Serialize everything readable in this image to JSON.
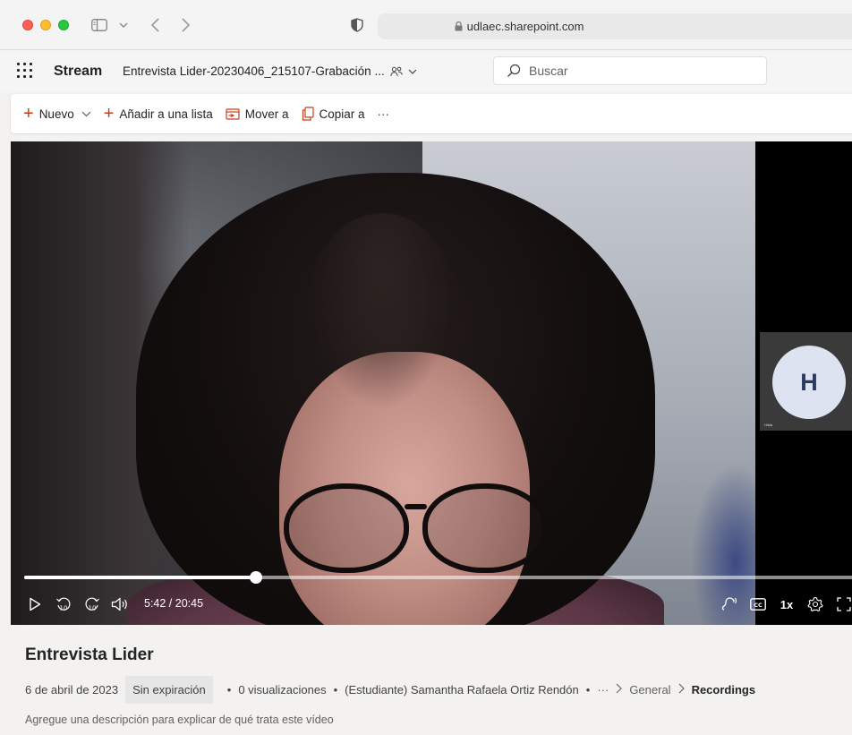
{
  "browser": {
    "url": "udlaec.sharepoint.com"
  },
  "app": {
    "name": "Stream",
    "document_title": "Entrevista Lider-20230406_215107-Grabación ...",
    "search_placeholder": "Buscar"
  },
  "commands": {
    "new": "Nuevo",
    "add_to_list": "Añadir a una lista",
    "move_to": "Mover a",
    "copy_to": "Copiar a",
    "more": "···"
  },
  "player": {
    "participant_initial": "H",
    "participant_name": "Hilda",
    "time": "5:42 / 20:45",
    "progress_fraction": 0.2738,
    "speed": "1x"
  },
  "video": {
    "title": "Entrevista Lider",
    "date": "6 de abril de 2023",
    "expiration": "Sin expiración",
    "views": "0 visualizaciones",
    "owner": "(Estudiante) Samantha Rafaela Ortiz Rendón",
    "breadcrumb_more": "···",
    "breadcrumb_general": "General",
    "breadcrumb_current": "Recordings",
    "description_prompt": "Agregue una descripción para explicar de qué trata este vídeo"
  }
}
